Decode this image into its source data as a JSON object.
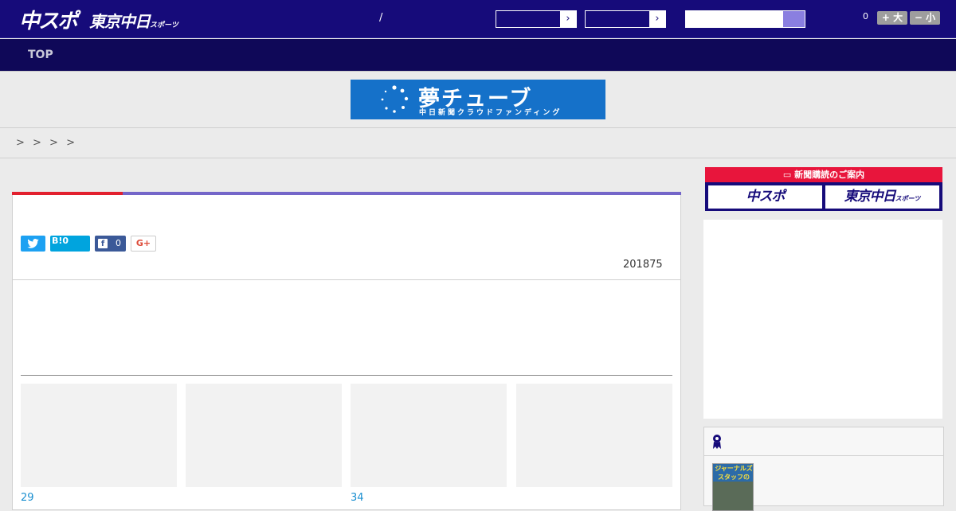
{
  "header": {
    "logo_main": "中スポ",
    "logo_tokyo": "東京中日",
    "logo_tokyo_suffix": "スポーツ",
    "separator": "/",
    "font_count": "0",
    "font_larger": "+ 大",
    "font_smaller": "− 小"
  },
  "nav": {
    "top": "TOP"
  },
  "banner": {
    "title": "夢チューブ",
    "subtitle": "中日新聞クラウドファンディング"
  },
  "breadcrumb": {
    "text": "> > > >"
  },
  "article": {
    "hatena_label": "B!",
    "hatena_count": "0",
    "facebook_icon": "f",
    "facebook_count": "0",
    "google_label": "G+",
    "date": "201875",
    "related": [
      {
        "number": "29"
      },
      {
        "number": ""
      },
      {
        "number": "34"
      },
      {
        "number": ""
      }
    ]
  },
  "sidebar": {
    "subscribe_title": "新聞購読のご案内",
    "subscribe_chuspo": "中スポ",
    "subscribe_tokyo": "東京中日",
    "subscribe_tokyo_suffix": "スポーツ",
    "ranking_thumb_text": "ジャーナルズ スタッフの"
  },
  "colors": {
    "header": "#160b7a",
    "nav": "#0f0858",
    "accent_red": "#e2202e",
    "accent_purple": "#7466c9",
    "banner_blue": "#1571c9",
    "link_blue": "#1a8fd0"
  },
  "icons": {
    "twitter": "twitter-icon",
    "hatena": "hatena-bookmark-icon",
    "facebook": "facebook-icon",
    "google_plus": "google-plus-icon",
    "ranking": "ranking-ribbon-icon",
    "select_arrow": "chevron-right-icon"
  }
}
